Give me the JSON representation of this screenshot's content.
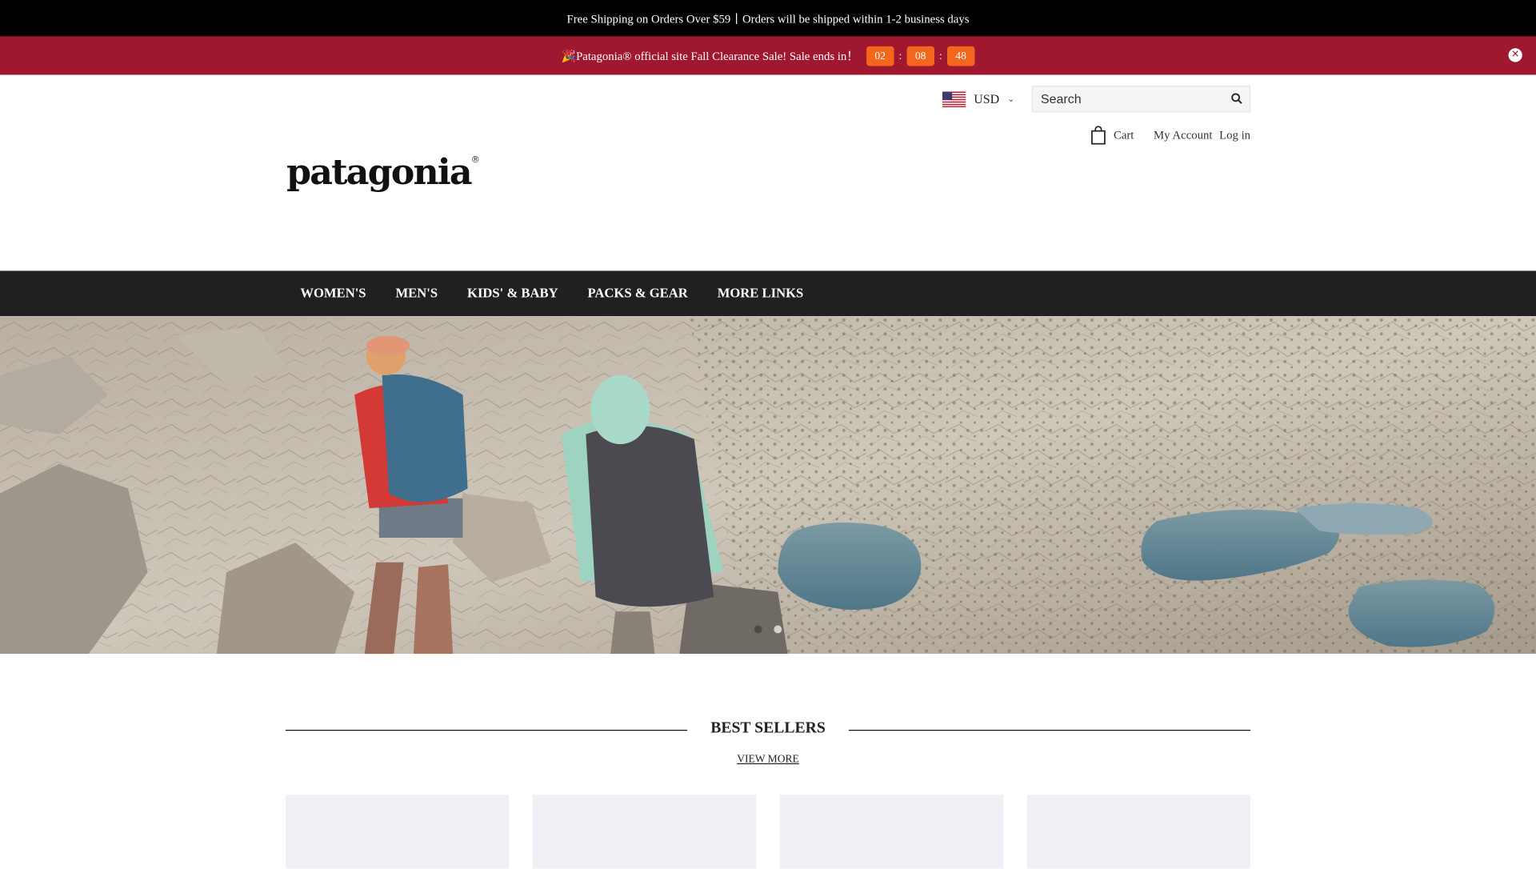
{
  "top_bar": {
    "text": "Free Shipping on Orders Over $59丨Orders will be shipped within 1-2 business days"
  },
  "sale_bar": {
    "text": "🎉Patagonia® official site Fall Clearance Sale! Sale ends in！",
    "countdown": {
      "hours": "02",
      "minutes": "08",
      "seconds": "48"
    },
    "close_icon": "close-icon",
    "bg_color": "#a0182f",
    "countdown_color": "#f2661d"
  },
  "header": {
    "currency": "USD",
    "currency_flag": "us-flag-icon",
    "search_placeholder": "Search",
    "cart_label": "Cart",
    "account_label": "My Account",
    "login_label": "Log in",
    "logo_text": "patagonia",
    "logo_mark": "®"
  },
  "nav": {
    "items": [
      {
        "label": "WOMEN'S"
      },
      {
        "label": "MEN'S"
      },
      {
        "label": "KIDS' & BABY"
      },
      {
        "label": "PACKS & GEAR"
      },
      {
        "label": "MORE LINKS"
      }
    ],
    "bg_color": "#202020"
  },
  "hero": {
    "image": "hikers-on-rocky-mountain-trail-near-alpine-lakes"
  },
  "best_sellers": {
    "title": "BEST SELLERS",
    "view_more": "VIEW MORE",
    "product_cards": 4
  }
}
